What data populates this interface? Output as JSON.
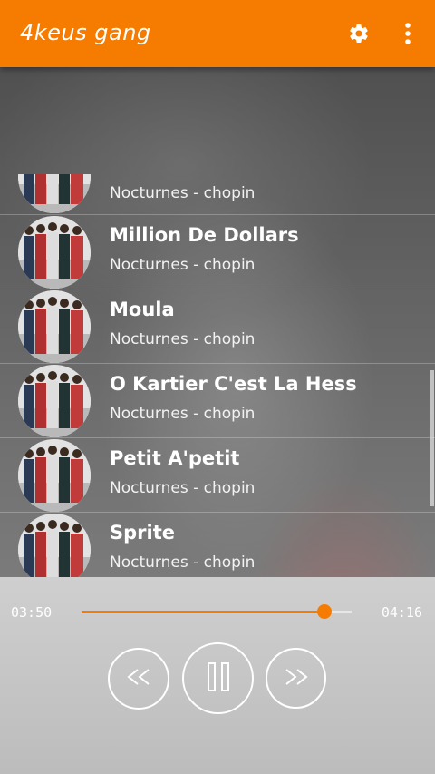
{
  "app": {
    "title": "4keus gang"
  },
  "songs": [
    {
      "title": "",
      "subtitle": "Nocturnes - chopin"
    },
    {
      "title": "Million De Dollars",
      "subtitle": "Nocturnes - chopin"
    },
    {
      "title": "Moula",
      "subtitle": "Nocturnes - chopin"
    },
    {
      "title": "O Kartier C'est La Hess",
      "subtitle": "Nocturnes - chopin"
    },
    {
      "title": "Petit A'petit",
      "subtitle": "Nocturnes - chopin"
    },
    {
      "title": "Sprite",
      "subtitle": "Nocturnes - chopin"
    }
  ],
  "player": {
    "current_time": "03:50",
    "total_time": "04:16",
    "progress": 0.9
  },
  "colors": {
    "accent": "#f57c00"
  },
  "icons": {
    "settings": "gear-icon",
    "more": "more-vert-icon",
    "prev": "rewind-icon",
    "pause": "pause-icon",
    "next": "fast-forward-icon"
  }
}
